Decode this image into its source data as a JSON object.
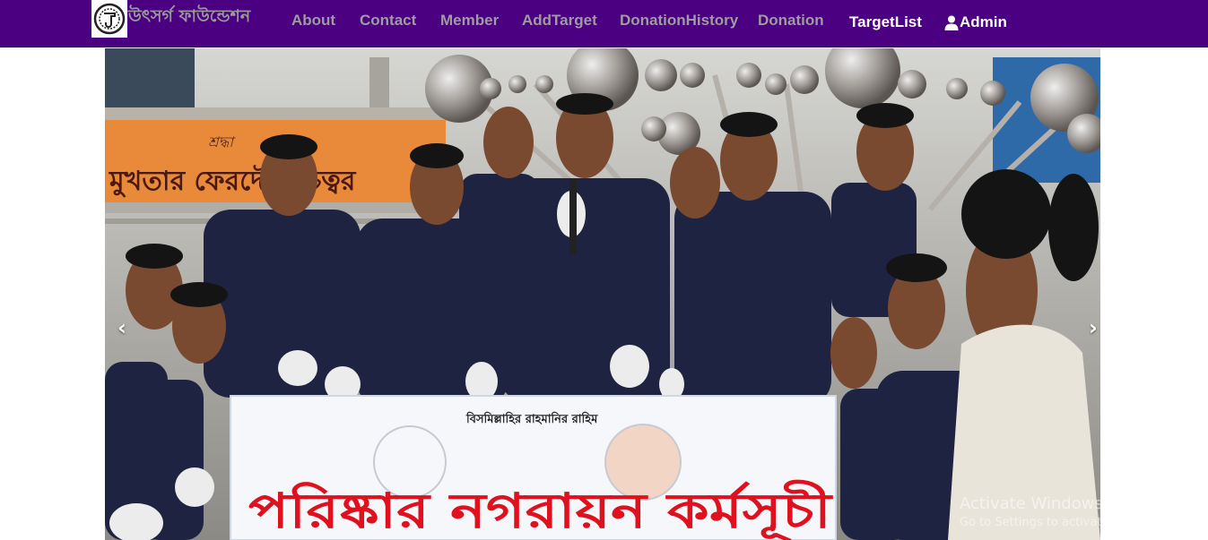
{
  "navbar": {
    "brand_name": "উৎসর্গ ফাউন্ডেশন",
    "links": [
      {
        "label": "About"
      },
      {
        "label": "Contact"
      },
      {
        "label": "Member"
      },
      {
        "label": "AddTarget"
      },
      {
        "label": "DonationHistory"
      },
      {
        "label": "Donation"
      },
      {
        "label": "TargetList"
      }
    ],
    "active_link": "TargetList",
    "admin_label": "Admin",
    "admin_icon": "user-icon",
    "background": "#4b0082",
    "link_color": "#9d9d9d",
    "active_color": "#ffffff"
  },
  "carousel": {
    "prev_glyph": "‹",
    "next_glyph": "›",
    "banner": {
      "top_text": "বিসমিল্লাহির রাহমানির রাহিম",
      "main_text": "পরিষ্কার নগরায়ন কর্মসূচী"
    },
    "sign_text": "মুখতার ফেরদৌসী চত্বর",
    "sign_script": "শ্রদ্ধা"
  },
  "watermark": {
    "line1": "Activate Windows",
    "line2": "Go to Settings to activate Windows."
  }
}
